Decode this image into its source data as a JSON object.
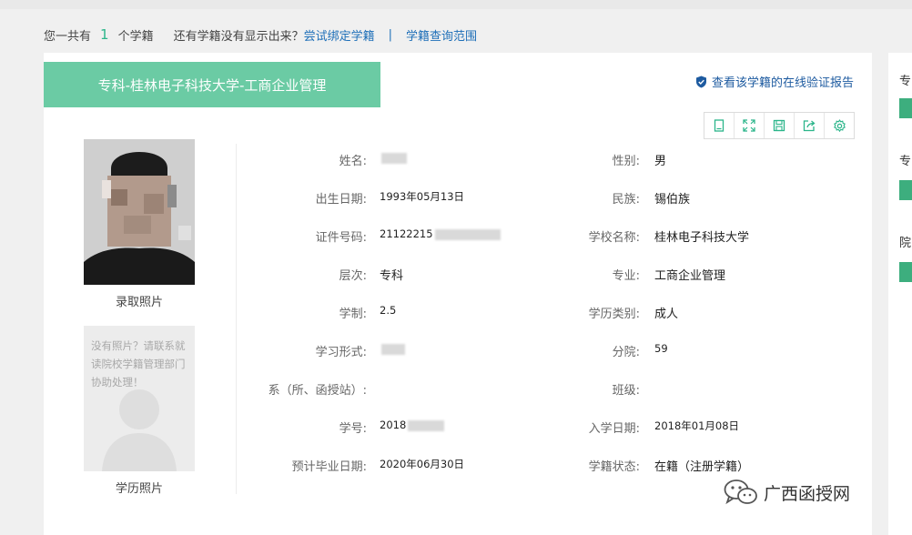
{
  "summary": {
    "prefix": "您一共有",
    "count": "1",
    "suffix": "个学籍",
    "question": "还有学籍没有显示出来？",
    "bind_link": "尝试绑定学籍",
    "separator": "|",
    "scope_link": "学籍查询范围"
  },
  "card": {
    "title": "专科-桂林电子科技大学-工商企业管理",
    "verify_link": "查看该学籍的在线验证报告",
    "toolbar_icons": [
      "document-icon",
      "expand-icon",
      "save-icon",
      "share-icon",
      "settings-icon"
    ]
  },
  "photos": {
    "admission_caption": "录取照片",
    "placeholder_text": "没有照片？请联系就读院校学籍管理部门协助处理！",
    "diploma_caption": "学历照片"
  },
  "fields": {
    "name_label": "姓名:",
    "gender_label": "性别:",
    "gender": "男",
    "birth_label": "出生日期:",
    "birth": "1993年05月13日",
    "ethnicity_label": "民族:",
    "ethnicity": "锡伯族",
    "id_label": "证件号码:",
    "id_prefix": "21122215",
    "school_label": "学校名称:",
    "school": "桂林电子科技大学",
    "level_label": "层次:",
    "level": "专科",
    "major_label": "专业:",
    "major": "工商企业管理",
    "duration_label": "学制:",
    "duration": "2.5",
    "edu_type_label": "学历类别:",
    "edu_type": "成人",
    "study_form_label": "学习形式:",
    "branch_label": "分院:",
    "branch": "59",
    "dept_label": "系（所、函授站）:",
    "class_label": "班级:",
    "student_no_label": "学号:",
    "student_no_prefix": "2018",
    "enroll_label": "入学日期:",
    "enroll": "2018年01月08日",
    "grad_label": "预计毕业日期:",
    "grad": "2020年06月30日",
    "status_label": "学籍状态:",
    "status": "在籍（注册学籍）"
  },
  "side_panel": {
    "labels": [
      "专",
      "专",
      "院"
    ]
  },
  "watermark": {
    "text": "广西函授网"
  },
  "colors": {
    "banner": "#6bcba4",
    "accent_green": "#2bb58a",
    "link_blue": "#1e6fb8"
  }
}
